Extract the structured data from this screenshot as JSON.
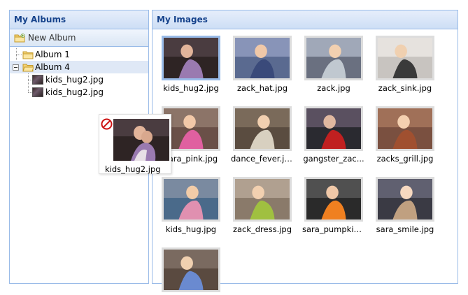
{
  "albums_panel": {
    "title": "My Albums",
    "new_album_label": "New Album",
    "tree": [
      {
        "label": "Album 1",
        "type": "folder"
      },
      {
        "label": "Album 4",
        "type": "folder",
        "expanded": true,
        "selected": true,
        "children": [
          {
            "label": "kids_hug2.jpg",
            "type": "image"
          },
          {
            "label": "kids_hug2.jpg",
            "type": "image"
          }
        ]
      }
    ]
  },
  "images_panel": {
    "title": "My Images",
    "images": [
      {
        "label": "kids_hug2.jpg",
        "selected": true
      },
      {
        "label": "zack_hat.jpg"
      },
      {
        "label": "zack.jpg"
      },
      {
        "label": "zack_sink.jpg"
      },
      {
        "label": "sara_pink.jpg"
      },
      {
        "label": "dance_fever.jpg"
      },
      {
        "label": "gangster_zac..."
      },
      {
        "label": "zacks_grill.jpg"
      },
      {
        "label": "kids_hug.jpg"
      },
      {
        "label": "zack_dress.jpg"
      },
      {
        "label": "sara_pumpkin..."
      },
      {
        "label": "sara_smile.jpg"
      },
      {
        "label": ""
      }
    ]
  },
  "drag_proxy": {
    "label": "kids_hug2.jpg",
    "status_icon": "no-drop-icon"
  },
  "colors": {
    "header_text": "#15428b",
    "border": "#99bbe8",
    "selection": "#dfe8f6"
  }
}
